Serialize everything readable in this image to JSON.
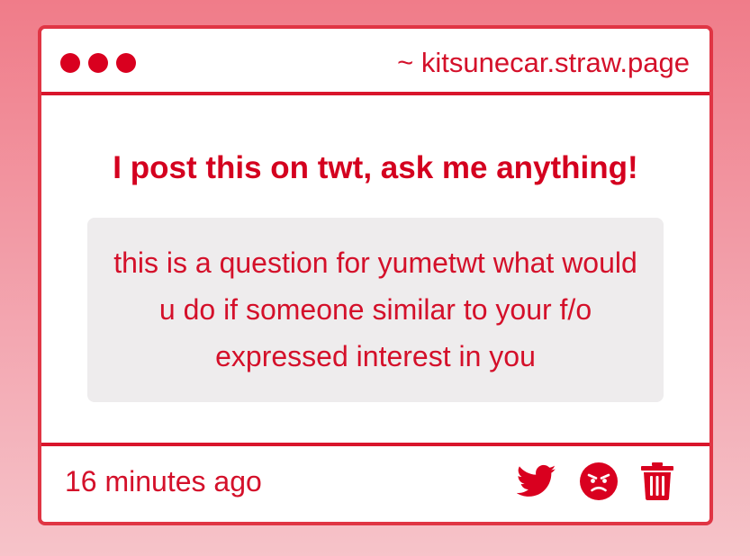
{
  "window": {
    "url": "~ kitsunecar.straw.page"
  },
  "prompt": {
    "title": "I post this on twt, ask me anything!"
  },
  "question": {
    "text": "this is a question for yumetwt what would u do if someone similar to your f/o expressed interest in you"
  },
  "footer": {
    "timestamp": "16 minutes ago",
    "actions": [
      {
        "icon": "twitter-bird-icon"
      },
      {
        "icon": "angry-face-icon"
      },
      {
        "icon": "trash-icon"
      }
    ]
  },
  "colors": {
    "accent": "#d4102a",
    "border": "#e03544",
    "question_bg": "#eeeced",
    "card_bg": "#ffffff"
  }
}
